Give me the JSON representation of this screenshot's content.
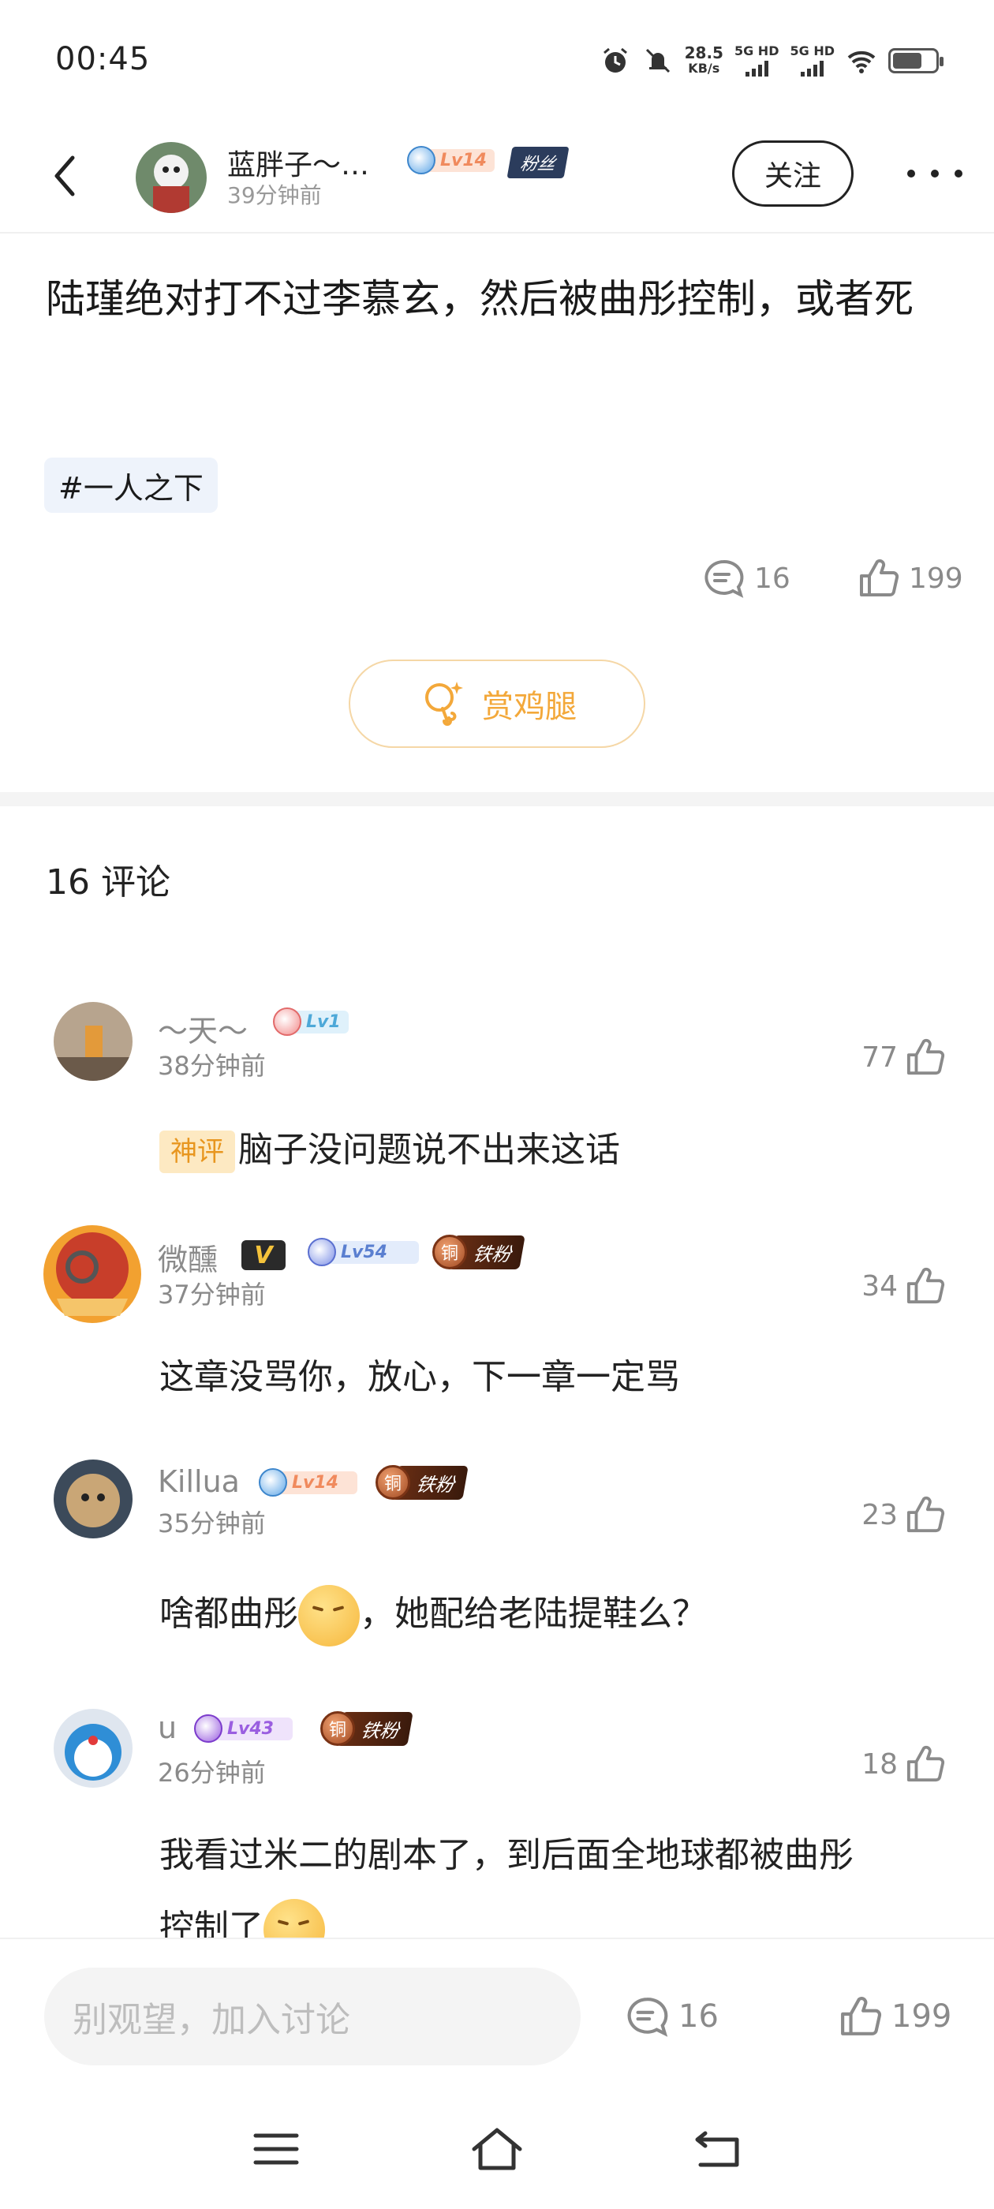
{
  "status_bar": {
    "time": "00:45",
    "net_speed_value": "28.5",
    "net_speed_unit": "KB/s",
    "sim1_label": "5G HD",
    "sim2_label": "5G HD",
    "battery_level": 0.7
  },
  "header": {
    "username": "蓝胖子～…",
    "post_time": "39分钟前",
    "level": "Lv14",
    "fan_tag": "粉丝",
    "follow_label": "关注"
  },
  "post": {
    "text": "陆瑾绝对打不过李慕玄，然后被曲彤控制，或者死",
    "topic": "#一人之下",
    "comment_count": "16",
    "like_count": "199",
    "reward_label": "赏鸡腿"
  },
  "comments_section": {
    "heading": "16 评论",
    "items": [
      {
        "name": "～天～",
        "level": "Lv1",
        "time": "38分钟前",
        "likes": "77",
        "tag": "神评",
        "text": "脑子没问题说不出来这话"
      },
      {
        "name": "微醺",
        "vip": "V",
        "level": "Lv54",
        "medal": "铜",
        "fan_badge": "铁粉",
        "time": "37分钟前",
        "likes": "34",
        "text": "这章没骂你，放心，下一章一定骂"
      },
      {
        "name": "Killua",
        "level": "Lv14",
        "medal": "铜",
        "fan_badge": "铁粉",
        "time": "35分钟前",
        "likes": "23",
        "text_before": "啥都曲彤",
        "text_after": "，她配给老陆提鞋么？"
      },
      {
        "name": "u",
        "level": "Lv43",
        "medal": "铜",
        "fan_badge": "铁粉",
        "time": "26分钟前",
        "likes": "18",
        "text_line1": "我看过米二的剧本了，到后面全地球都被曲彤",
        "text_line2": "控制了"
      }
    ]
  },
  "bottom_bar": {
    "input_placeholder": "别观望，加入讨论",
    "comment_count": "16",
    "like_count": "199"
  },
  "icons": {
    "back": "back-arrow-icon",
    "more": "more-dots-icon",
    "comment": "comment-bubble-icon",
    "like": "thumbs-up-icon",
    "reward": "chicken-leg-icon",
    "menu": "menu-icon",
    "home": "home-icon",
    "return": "return-icon"
  },
  "colors": {
    "accent_orange": "#f3a83a",
    "topic_bg": "#eef3fb",
    "muted_text": "#8a8a8a"
  }
}
